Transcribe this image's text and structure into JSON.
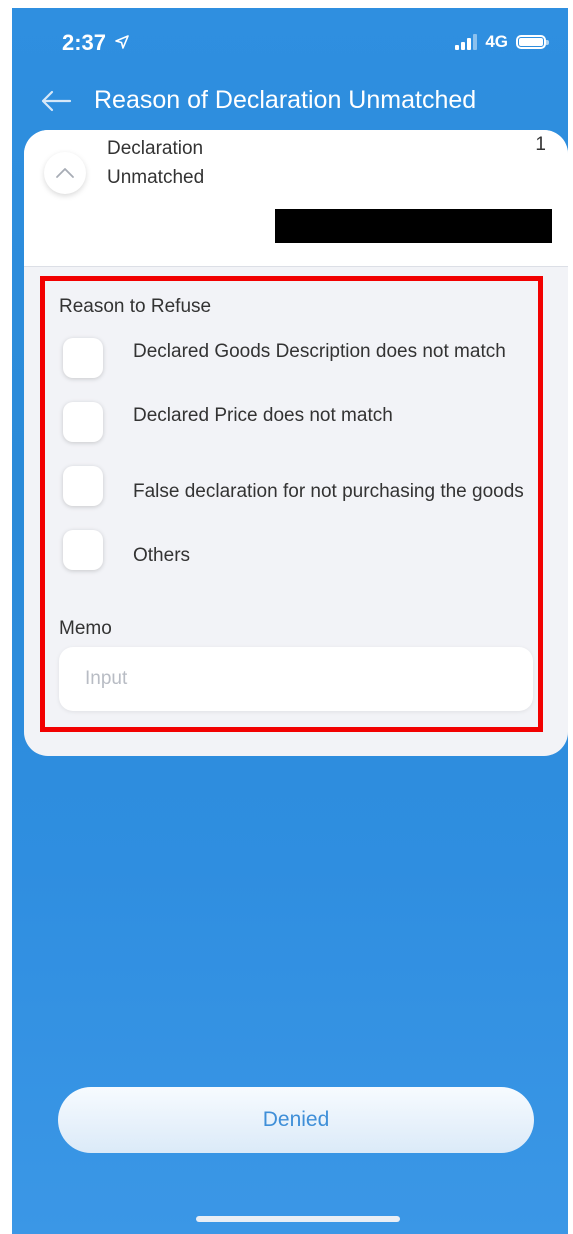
{
  "status_bar": {
    "time": "2:37",
    "network": "4G",
    "location_icon": "location-arrow-icon",
    "signal_icon": "signal-bars-icon",
    "battery_icon": "battery-icon"
  },
  "header": {
    "title": "Reason of Declaration Unmatched",
    "back_icon": "arrow-left-icon"
  },
  "card": {
    "title": "Declaration Unmatched",
    "count": "1",
    "collapse_icon": "chevron-up-icon"
  },
  "form": {
    "reason_label": "Reason to Refuse",
    "options": [
      {
        "label": "Declared Goods Description does not match",
        "checked": false
      },
      {
        "label": "Declared Price does not match",
        "checked": false
      },
      {
        "label": "False declaration for not purchasing the goods",
        "checked": false
      },
      {
        "label": "Others",
        "checked": false
      }
    ],
    "memo_label": "Memo",
    "memo_placeholder": "Input",
    "memo_value": ""
  },
  "footer": {
    "denied_label": "Denied"
  },
  "colors": {
    "background_blue": "#2f8fe0",
    "highlight_red": "#f20000",
    "button_text": "#3f8fd8"
  }
}
